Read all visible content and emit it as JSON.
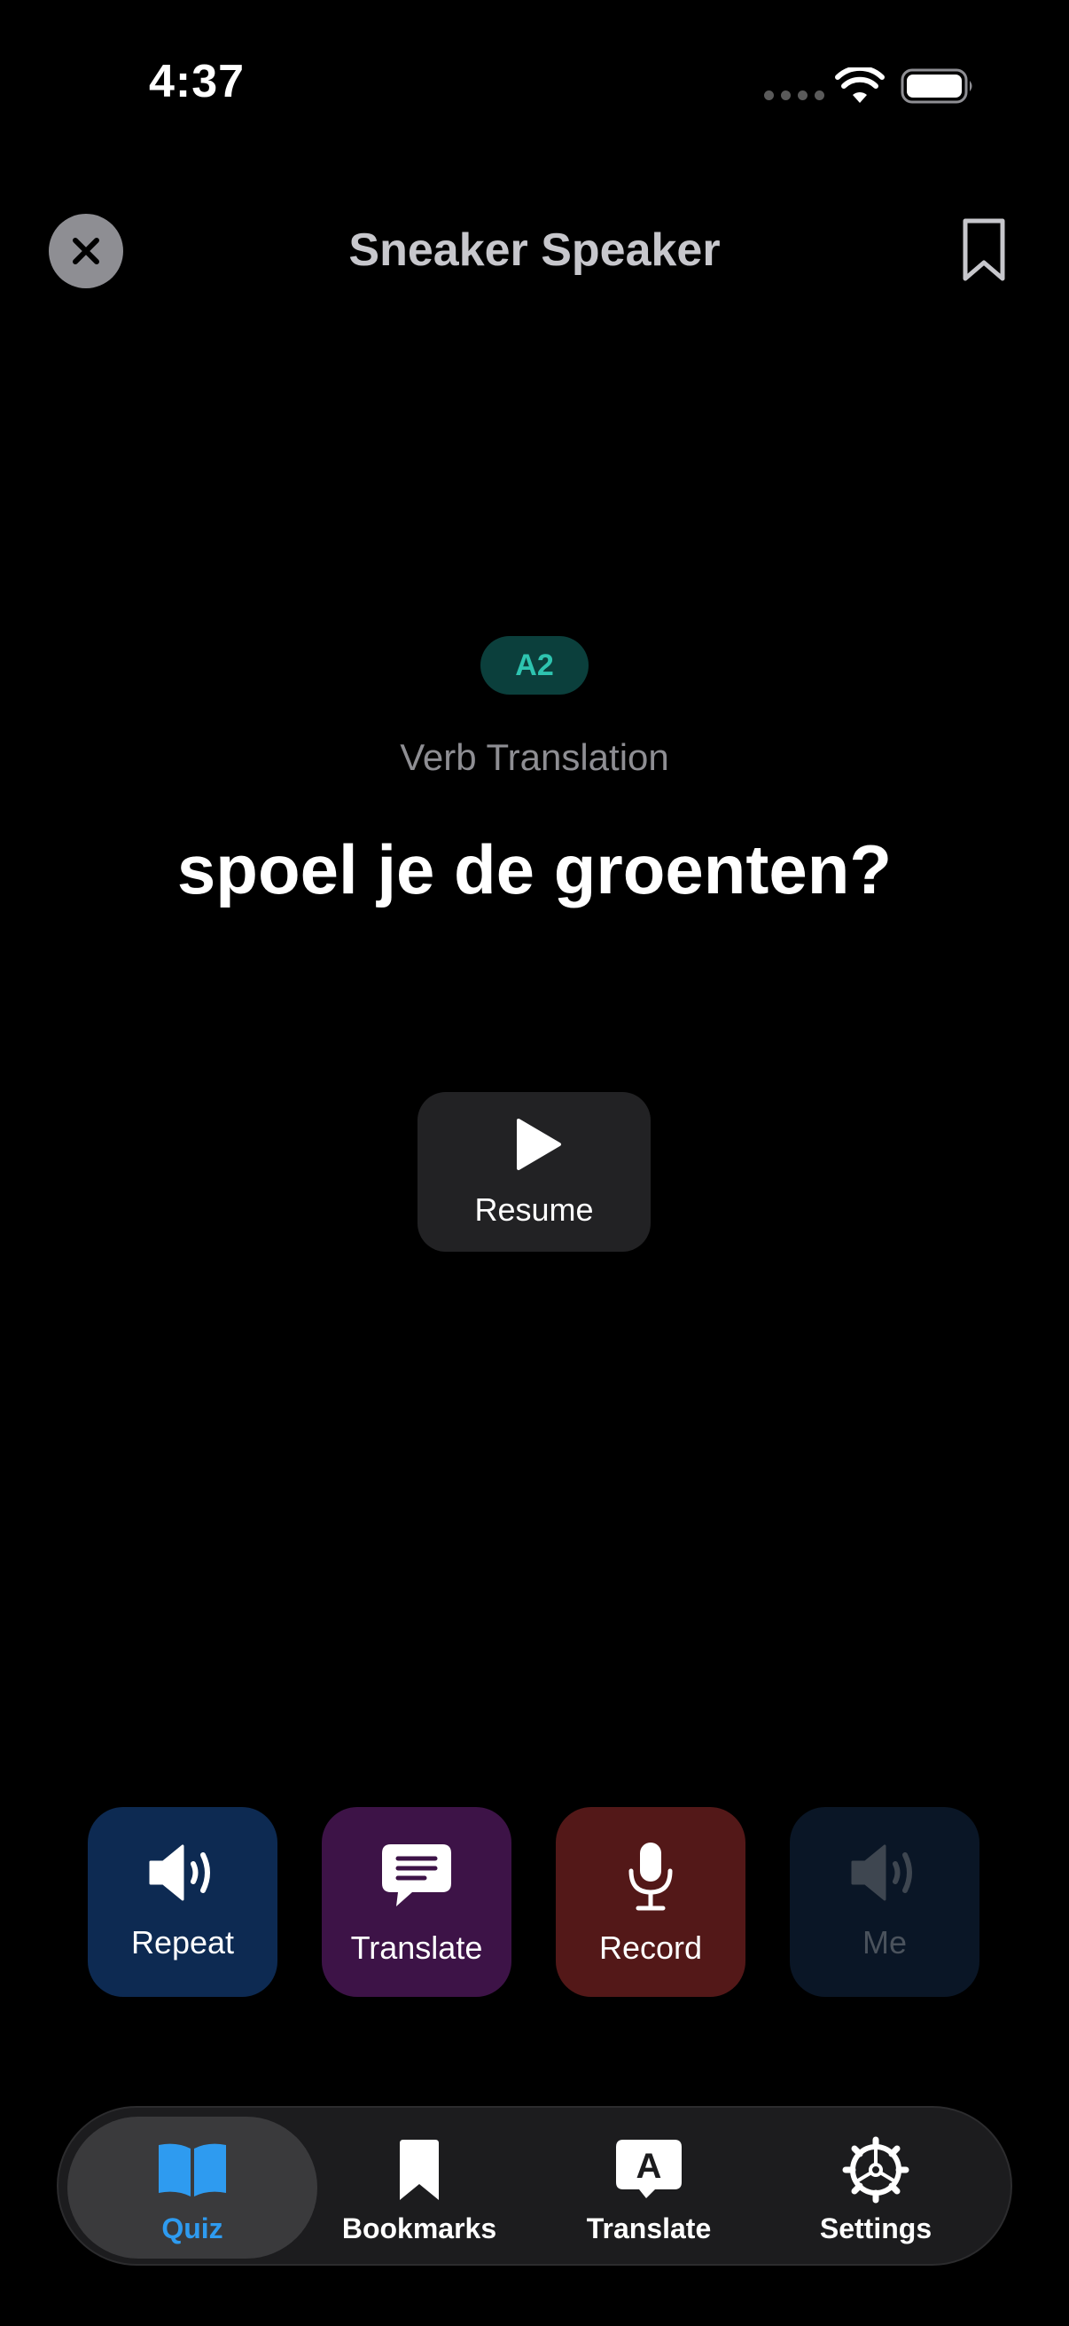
{
  "status_bar": {
    "time": "4:37"
  },
  "header": {
    "title": "Sneaker Speaker"
  },
  "card": {
    "level": "A2",
    "exercise_type": "Verb Translation",
    "sentence": "spoel je de groenten?",
    "resume_label": "Resume"
  },
  "actions": [
    {
      "label": "Repeat",
      "icon": "speaker-icon"
    },
    {
      "label": "Translate",
      "icon": "message-icon"
    },
    {
      "label": "Record",
      "icon": "microphone-icon"
    },
    {
      "label": "Me",
      "icon": "speaker-icon"
    }
  ],
  "tabs": [
    {
      "label": "Quiz",
      "icon": "book-icon",
      "selected": true
    },
    {
      "label": "Bookmarks",
      "icon": "bookmark-icon",
      "selected": false
    },
    {
      "label": "Translate",
      "icon": "translate-icon",
      "selected": false
    },
    {
      "label": "Settings",
      "icon": "gear-icon",
      "selected": false
    }
  ],
  "colors": {
    "accent": "#2e9bf0",
    "badge_text": "#2ec4b0",
    "repeat_bg": "#0d2a52",
    "translate_bg": "#3d1347",
    "record_bg": "#531818",
    "me_bg": "#0a1626"
  }
}
